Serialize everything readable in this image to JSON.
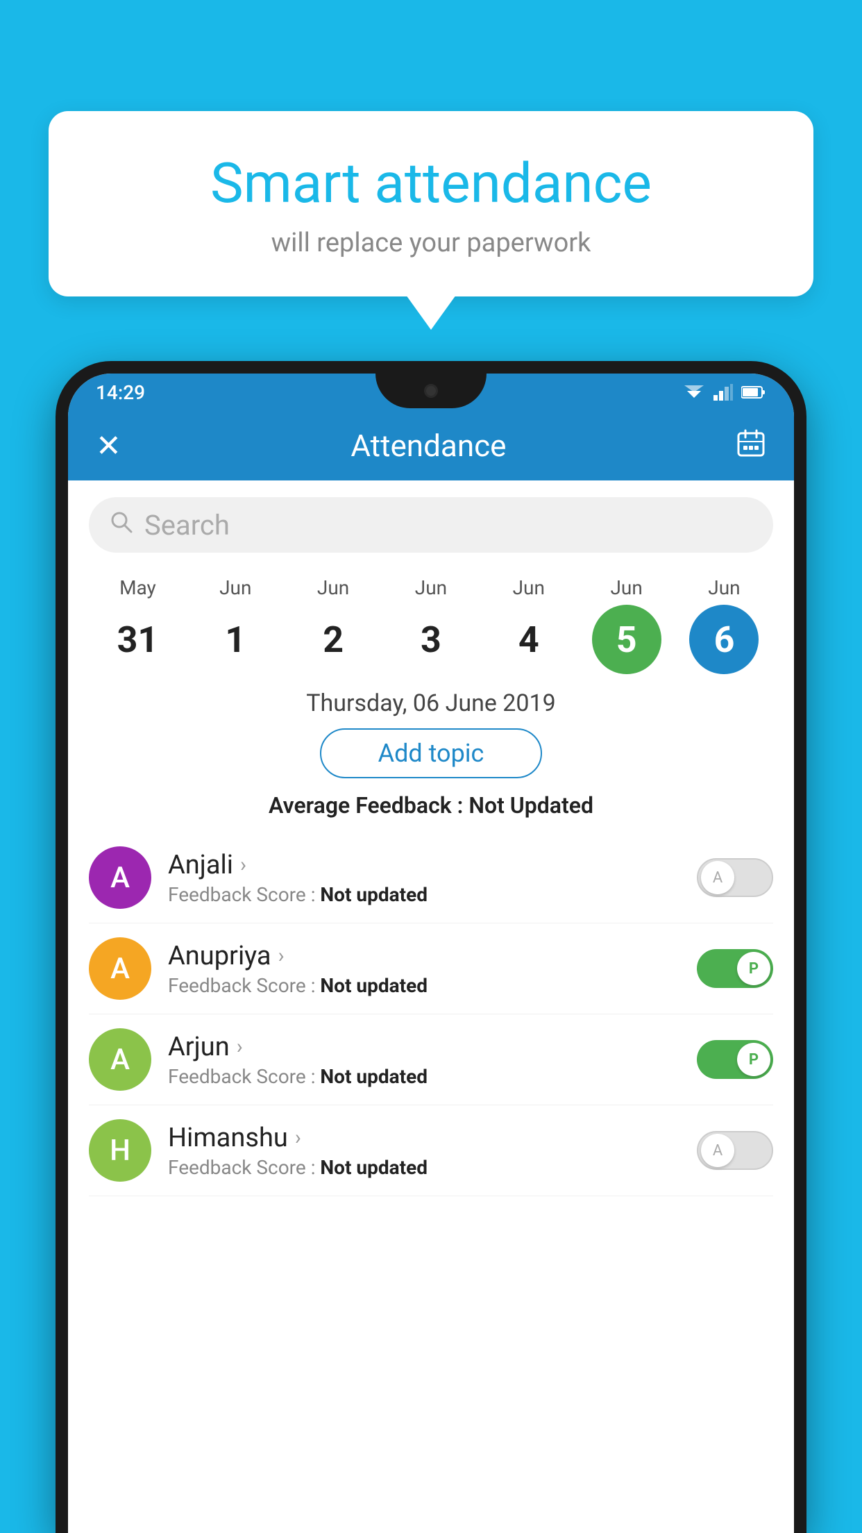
{
  "background_color": "#1ab8e8",
  "speech_bubble": {
    "title": "Smart attendance",
    "subtitle": "will replace your paperwork"
  },
  "status_bar": {
    "time": "14:29"
  },
  "app_header": {
    "title": "Attendance",
    "close_label": "✕",
    "calendar_icon": "📅"
  },
  "search": {
    "placeholder": "Search"
  },
  "calendar": {
    "days": [
      {
        "month": "May",
        "num": "31",
        "type": "normal"
      },
      {
        "month": "Jun",
        "num": "1",
        "type": "normal"
      },
      {
        "month": "Jun",
        "num": "2",
        "type": "normal"
      },
      {
        "month": "Jun",
        "num": "3",
        "type": "normal"
      },
      {
        "month": "Jun",
        "num": "4",
        "type": "normal"
      },
      {
        "month": "Jun",
        "num": "5",
        "type": "today"
      },
      {
        "month": "Jun",
        "num": "6",
        "type": "selected"
      }
    ]
  },
  "selected_date": "Thursday, 06 June 2019",
  "add_topic_label": "Add topic",
  "avg_feedback_label": "Average Feedback : ",
  "avg_feedback_value": "Not Updated",
  "students": [
    {
      "name": "Anjali",
      "avatar_letter": "A",
      "avatar_color": "#9c27b0",
      "feedback_label": "Feedback Score : ",
      "feedback_value": "Not updated",
      "toggle": "off",
      "toggle_letter": "A"
    },
    {
      "name": "Anupriya",
      "avatar_letter": "A",
      "avatar_color": "#f5a623",
      "feedback_label": "Feedback Score : ",
      "feedback_value": "Not updated",
      "toggle": "on",
      "toggle_letter": "P"
    },
    {
      "name": "Arjun",
      "avatar_letter": "A",
      "avatar_color": "#8bc34a",
      "feedback_label": "Feedback Score : ",
      "feedback_value": "Not updated",
      "toggle": "on",
      "toggle_letter": "P"
    },
    {
      "name": "Himanshu",
      "avatar_letter": "H",
      "avatar_color": "#8bc34a",
      "feedback_label": "Feedback Score : ",
      "feedback_value": "Not updated",
      "toggle": "off",
      "toggle_letter": "A"
    }
  ]
}
